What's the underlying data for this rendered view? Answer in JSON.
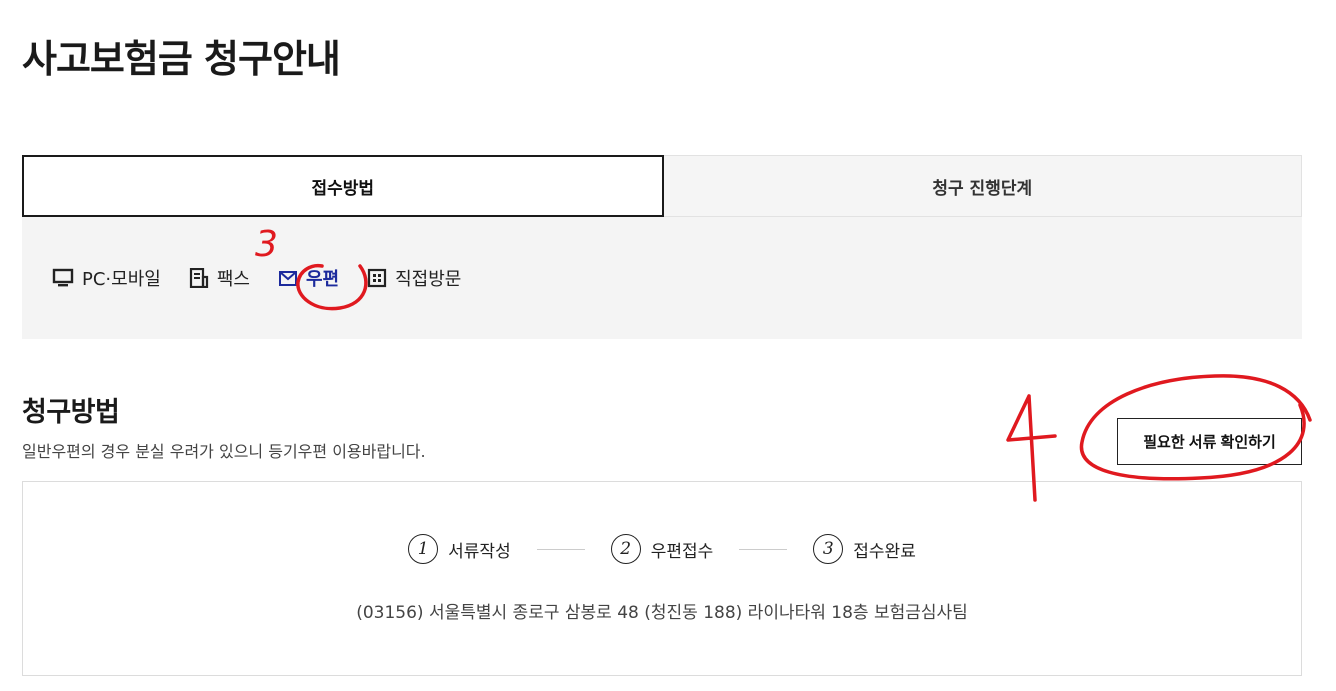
{
  "page_title": "사고보험금 청구안내",
  "tabs": [
    {
      "label": "접수방법",
      "active": true
    },
    {
      "label": "청구 진행단계",
      "active": false
    }
  ],
  "methods": [
    {
      "label": "PC·모바일",
      "icon": "monitor-icon"
    },
    {
      "label": "팩스",
      "icon": "fax-icon"
    },
    {
      "label": "우편",
      "icon": "mail-icon",
      "active": true
    },
    {
      "label": "직접방문",
      "icon": "building-icon"
    }
  ],
  "section": {
    "title": "청구방법",
    "description": "일반우편의 경우 분실 우려가 있으니 등기우편 이용바랍니다.",
    "docs_button": "필요한 서류 확인하기"
  },
  "steps": [
    {
      "num": "1",
      "label": "서류작성"
    },
    {
      "num": "2",
      "label": "우편접수"
    },
    {
      "num": "3",
      "label": "접수완료"
    }
  ],
  "address": "(03156) 서울특별시 종로구 삼봉로 48 (청진동 188) 라이나타워 18층 보험금심사팀",
  "annotations": {
    "mark_3": "3",
    "mark_4": "4",
    "color": "#e0191f"
  },
  "colors": {
    "active_method": "#1c2a9c",
    "panel_bg": "#f4f4f4"
  }
}
